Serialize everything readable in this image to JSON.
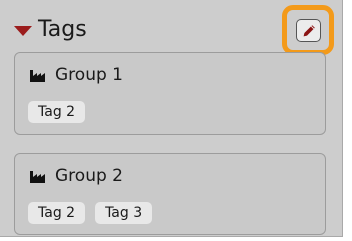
{
  "panel": {
    "title": "Tags",
    "caret_icon": "caret-down-icon",
    "edit_icon": "pencil-icon",
    "colors": {
      "caret": "#9b1c1c",
      "highlight": "#f39a1a"
    }
  },
  "groups": [
    {
      "label": "Group 1",
      "icon": "factory-icon",
      "tags": [
        "Tag 2"
      ]
    },
    {
      "label": "Group 2",
      "icon": "factory-icon",
      "tags": [
        "Tag 2",
        "Tag 3"
      ]
    }
  ]
}
